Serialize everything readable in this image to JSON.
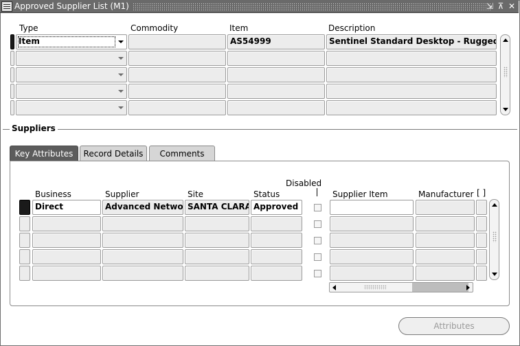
{
  "window": {
    "title": "Approved Supplier List (M1)",
    "controls": [
      "⇲",
      "⊼",
      "✕"
    ]
  },
  "asl": {
    "headers": {
      "type": "Type",
      "commodity": "Commodity",
      "item": "Item",
      "description": "Description"
    },
    "rows": [
      {
        "type": "Item",
        "commodity": "",
        "item": "AS54999",
        "description": "Sentinel Standard Desktop - Rugged"
      },
      {
        "type": "",
        "commodity": "",
        "item": "",
        "description": ""
      },
      {
        "type": "",
        "commodity": "",
        "item": "",
        "description": ""
      },
      {
        "type": "",
        "commodity": "",
        "item": "",
        "description": ""
      },
      {
        "type": "",
        "commodity": "",
        "item": "",
        "description": ""
      }
    ]
  },
  "suppliers": {
    "section_title": "Suppliers",
    "tabs": [
      {
        "label": "Key Attributes",
        "active": true
      },
      {
        "label": "Record Details",
        "active": false
      },
      {
        "label": "Comments",
        "active": false
      }
    ],
    "headers": {
      "business": "Business",
      "supplier": "Supplier",
      "site": "Site",
      "status": "Status",
      "disabled": "Disabled",
      "supplier_item": "Supplier Item",
      "manufacturer": "Manufacturer",
      "folder": "[ ]"
    },
    "rows": [
      {
        "business": "Direct",
        "supplier": "Advanced Network",
        "site": "SANTA CLARA",
        "status": "Approved",
        "supplier_item": "",
        "manufacturer": ""
      },
      {
        "business": "",
        "supplier": "",
        "site": "",
        "status": "",
        "supplier_item": "",
        "manufacturer": ""
      },
      {
        "business": "",
        "supplier": "",
        "site": "",
        "status": "",
        "supplier_item": "",
        "manufacturer": ""
      },
      {
        "business": "",
        "supplier": "",
        "site": "",
        "status": "",
        "supplier_item": "",
        "manufacturer": ""
      },
      {
        "business": "",
        "supplier": "",
        "site": "",
        "status": "",
        "supplier_item": "",
        "manufacturer": ""
      }
    ]
  },
  "actions": {
    "attributes_label": "Attributes"
  }
}
